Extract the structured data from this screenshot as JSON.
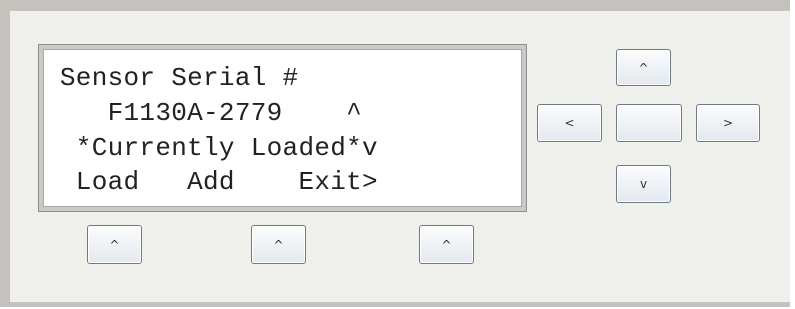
{
  "lcd": {
    "lines": [
      " Sensor Serial #",
      "    F1130A-2779    ^",
      "  *Currently Loaded*v",
      "  Load   Add    Exit>"
    ]
  },
  "softkeys": {
    "left": "^",
    "middle": "^",
    "right": "^"
  },
  "dpad": {
    "up": "^",
    "left": "<",
    "center": "",
    "right": ">",
    "down": "v"
  }
}
